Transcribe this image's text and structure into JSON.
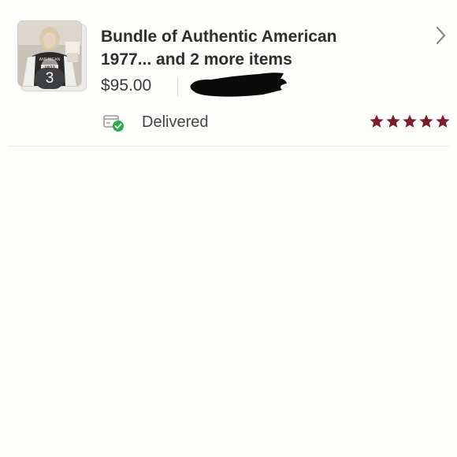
{
  "order": {
    "title_line1": "Bundle of Authentic American",
    "title_line2": "1977... and 2 more items",
    "price": "$95.00",
    "item_count": "3",
    "status": "Delivered",
    "rating": 5,
    "rating_max": 5,
    "thumbnail_icon": "product-photo-thumbnail",
    "status_icon": "delivered-package-check-icon",
    "nav_icon": "chevron-right-icon"
  },
  "colors": {
    "star": "#7a1f2b",
    "status_check": "#2faa4a",
    "badge_bg": "#3d3f41",
    "chevron": "#8a8a8a",
    "background": "#fdfdfc"
  }
}
